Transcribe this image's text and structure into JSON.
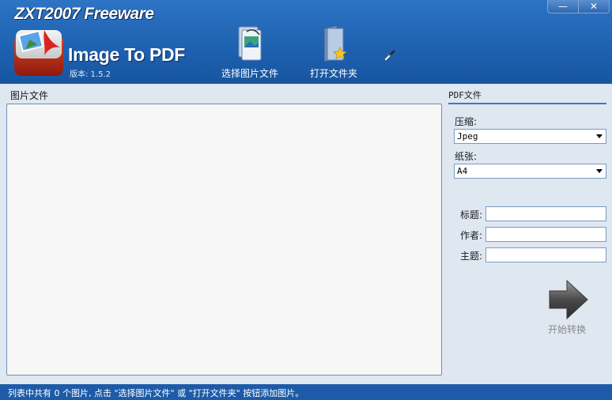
{
  "header": {
    "app_title": "ZXT2007 Freeware",
    "product_name": "Image To PDF",
    "version": "版本: 1.5.2",
    "toolbar": {
      "select_images": "选择图片文件",
      "open_folder": "打开文件夹"
    },
    "window_controls": {
      "minimize": "—",
      "close": "✕"
    }
  },
  "left_panel": {
    "label": "图片文件"
  },
  "right_panel": {
    "label": "PDF文件",
    "compression_label": "压缩:",
    "compression_value": "Jpeg",
    "paper_label": "纸张:",
    "paper_value": "A4",
    "title_label": "标题:",
    "title_value": "",
    "author_label": "作者:",
    "author_value": "",
    "subject_label": "主题:",
    "subject_value": "",
    "convert_label": "开始转换"
  },
  "status_bar": {
    "text": "列表中共有 0 个图片, 点击 \"选择图片文件\" 或 \"打开文件夹\" 按钮添加图片。"
  },
  "colors": {
    "header_blue": "#1f62b2",
    "status_blue": "#1d5ba8",
    "accent_rule": "#3b79c4"
  },
  "icons": [
    "app-logo-icon",
    "select-images-icon",
    "open-folder-icon",
    "brush-icon",
    "convert-arrow-icon"
  ]
}
